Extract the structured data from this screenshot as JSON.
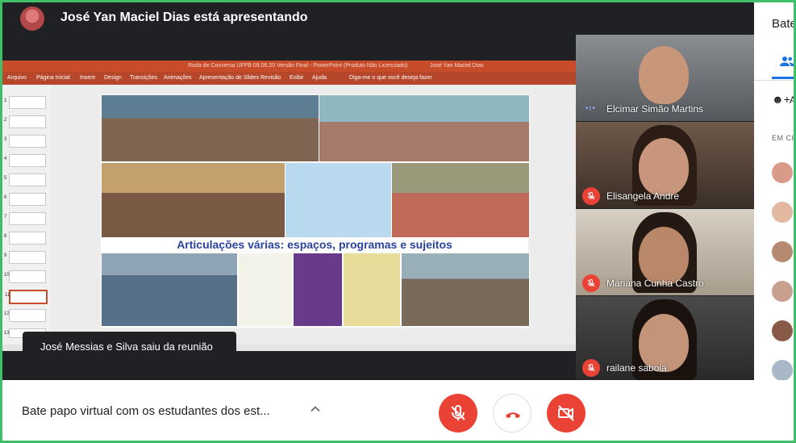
{
  "presenter": {
    "text": "José Yan Maciel Dias está apresentando"
  },
  "ppt": {
    "title_center": "Roda de Conversa UFPB 09.06.20 Versão Final - PowerPoint (Produto Não Licenciado)",
    "title_user": "José Yan Maciel Dias",
    "ribbon": [
      "Arquivo",
      "Página Inicial",
      "Inserir",
      "Design",
      "Transições",
      "Animações",
      "Apresentação de Slides",
      "Revisão",
      "Exibir",
      "Ajuda",
      "Diga-me o que você deseja fazer"
    ],
    "slide_banner": "Articulações várias: espaços, programas e sujeitos",
    "thumb_numbers": [
      "1",
      "2",
      "3",
      "4",
      "5",
      "6",
      "7",
      "8",
      "9",
      "10",
      "11",
      "12",
      "13"
    ]
  },
  "toast": {
    "text": "José Messias e Silva saiu da reunião"
  },
  "participants": [
    {
      "name": "Elcimar Simão Martins",
      "muted": false
    },
    {
      "name": "Elisangela Andre",
      "muted": true
    },
    {
      "name": "Mariana Cunha Castro",
      "muted": true
    },
    {
      "name": "railane saboia",
      "muted": true
    }
  ],
  "panel": {
    "title": "Bate",
    "add_text": "A",
    "section_label": "EM CH"
  },
  "bottom": {
    "meeting_title": "Bate papo virtual com os estudantes dos est..."
  },
  "icons": {
    "mic_off": "mic-off-icon",
    "end_call": "phone-hangup-icon",
    "cam_off": "camera-off-icon",
    "people": "people-icon",
    "add_person": "add-person-icon",
    "caret": "chevron-up-icon"
  },
  "colors": {
    "accent_red": "#ea4335",
    "frame_green": "#3fbf6a",
    "ppt_orange": "#b7472a",
    "link_blue": "#1a73e8"
  }
}
